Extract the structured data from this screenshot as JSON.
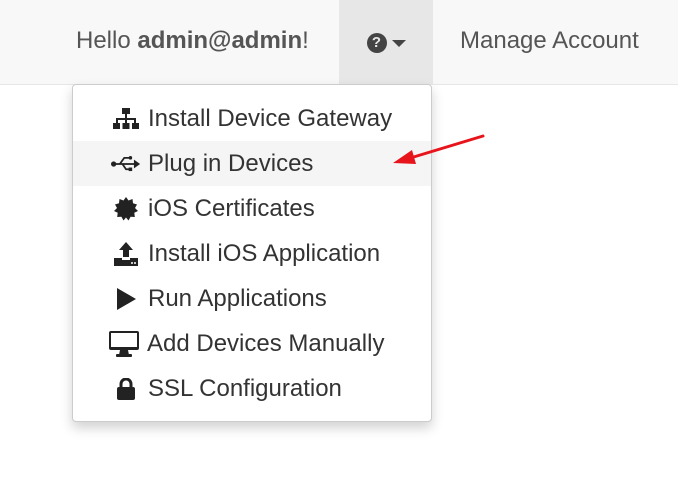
{
  "header": {
    "greeting_prefix": "Hello ",
    "username": "admin@admin",
    "greeting_suffix": "!",
    "help_icon": "question-circle-icon",
    "manage_account_label": "Manage Account"
  },
  "dropdown": {
    "items": [
      {
        "label": "Install Device Gateway",
        "icon": "sitemap-icon"
      },
      {
        "label": "Plug in Devices",
        "icon": "usb-icon",
        "active": true
      },
      {
        "label": "iOS Certificates",
        "icon": "certificate-icon"
      },
      {
        "label": "Install iOS Application",
        "icon": "upload-icon"
      },
      {
        "label": "Run Applications",
        "icon": "play-icon"
      },
      {
        "label": "Add Devices Manually",
        "icon": "desktop-icon"
      },
      {
        "label": "SSL Configuration",
        "icon": "lock-icon"
      }
    ]
  },
  "colors": {
    "navbar_bg": "#f8f8f8",
    "help_toggle_bg": "#e7e7e7",
    "active_item_bg": "#f5f5f5",
    "arrow": "#e8141b"
  }
}
